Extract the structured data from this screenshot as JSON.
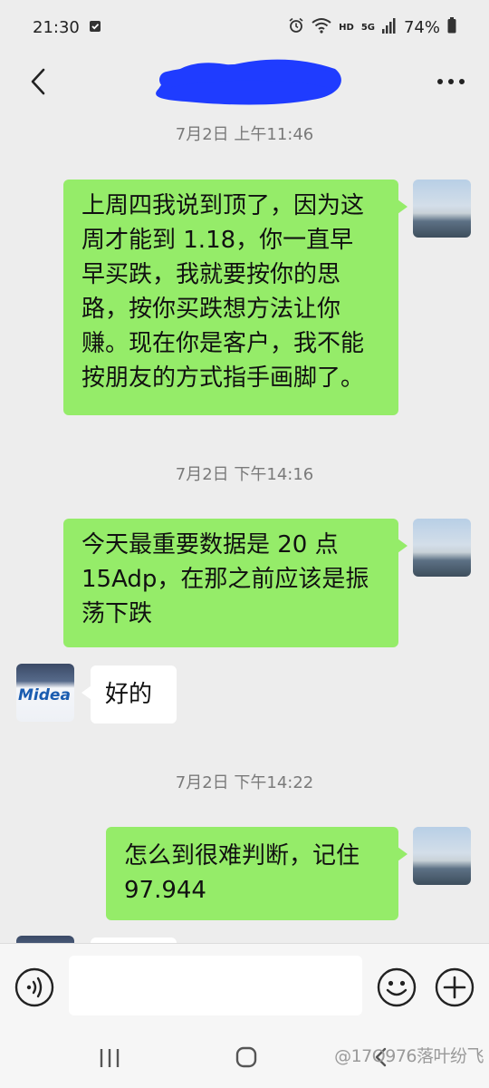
{
  "status_bar": {
    "time": "21:30",
    "network_labels": [
      "HD",
      "5G"
    ],
    "battery": "74%"
  },
  "header": {
    "title_redacted": true
  },
  "messages": [
    {
      "type": "timestamp",
      "text": "7月2日 上午11:46"
    },
    {
      "type": "message",
      "side": "self",
      "lines": [
        "上周四我说到顶了，因为这",
        "周才能到 1.18，你一直早",
        "早买跌，我就要按你的思",
        "路，按你买跌想方法让你",
        "赚。现在你是客户，我不能",
        "按朋友的方式指手画脚了。"
      ]
    },
    {
      "type": "timestamp",
      "text": "7月2日 下午14:16"
    },
    {
      "type": "message",
      "side": "self",
      "lines": [
        "今天最重要数据是 20 点",
        "15Adp，在那之前应该是振",
        "荡下跌"
      ]
    },
    {
      "type": "message",
      "side": "other",
      "lines": [
        "好的"
      ],
      "avatar_text": "Midea"
    },
    {
      "type": "timestamp",
      "text": "7月2日 下午14:22"
    },
    {
      "type": "message",
      "side": "self",
      "lines": [
        "怎么到很难判断，记住",
        "97.944"
      ]
    }
  ],
  "input_bar": {
    "text_value": "",
    "icons": [
      "voice-icon",
      "emoji-icon",
      "plus-icon"
    ]
  },
  "watermark": "@17O976落叶纷飞",
  "colors": {
    "background": "#ededed",
    "self_bubble": "#95ec69",
    "other_bubble": "#ffffff",
    "timestamp": "#7a7a7a",
    "redaction": "#1f3cff"
  }
}
